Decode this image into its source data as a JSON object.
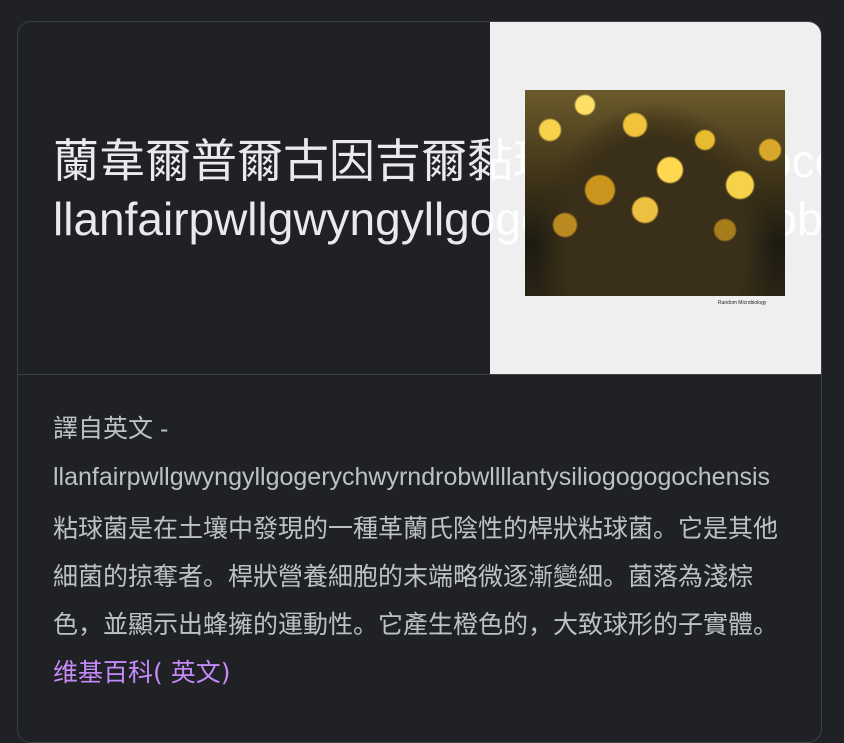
{
  "header": {
    "title_line1": "蘭韋爾普爾古因吉爾黏球菌 (Myxococcus",
    "title_line2": "llanfairpwllgwyngyllgogerychwyrndrobwllllantysiliogogogochensis)",
    "thumbnail_caption": "Random Microbiology"
  },
  "body": {
    "source_label": "譯自英文 -",
    "article_name": "llanfairpwllgwyngyllgogerychwyrndrobwllllantysiliogogogochensis",
    "description": "粘球菌是在土壤中發現的一種革蘭氏陰性的桿狀粘球菌。它是其他細菌的掠奪者。桿狀營養細胞的末端略微逐漸變細。菌落為淺棕色，並顯示出蜂擁的運動性。它產生橙色的，大致球形的子實體。",
    "link_wiki": "维基百科",
    "link_lang": "( 英文)"
  },
  "colors": {
    "background": "#202124",
    "text": "#bdc1c6",
    "title": "#e8eaed",
    "link": "#c58af9",
    "border": "#3c4043"
  }
}
